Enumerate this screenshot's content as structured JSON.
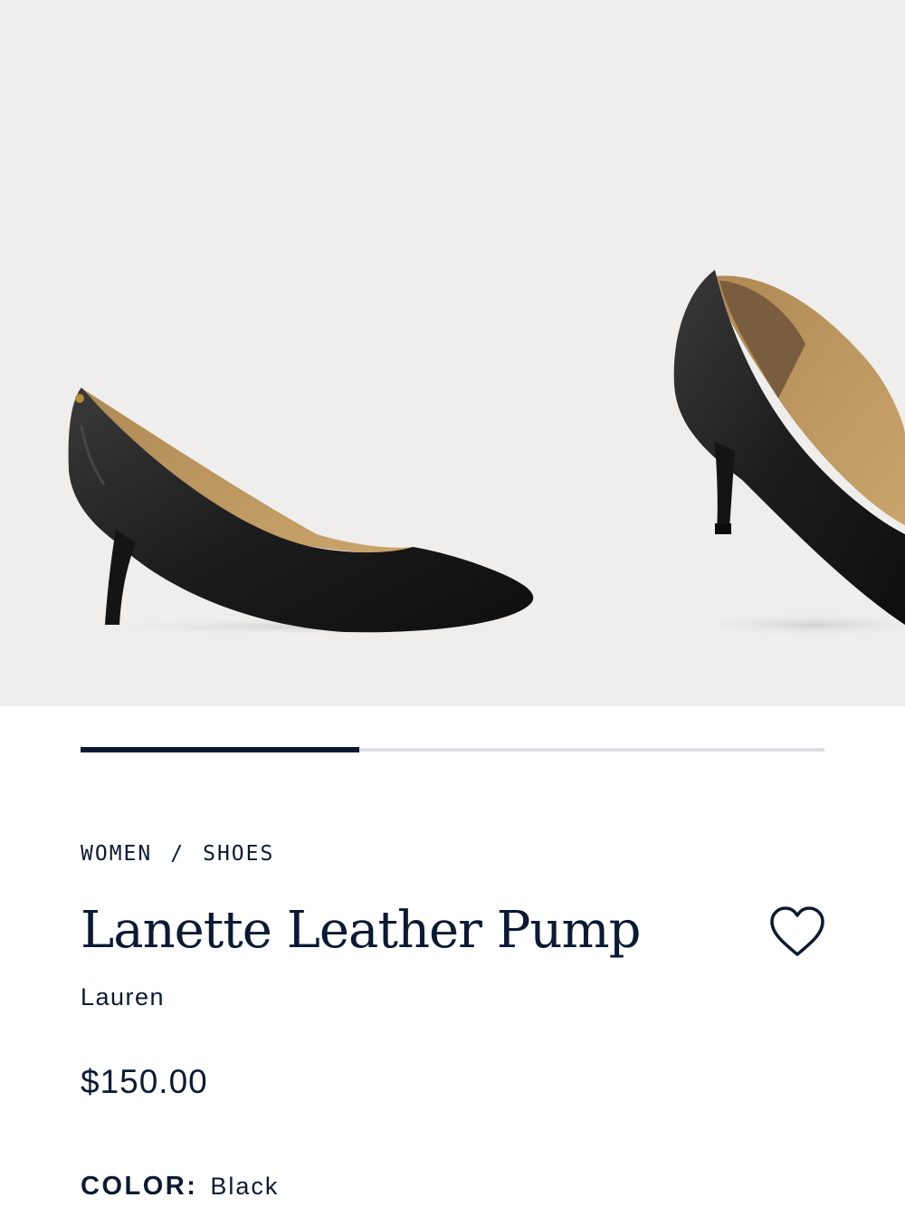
{
  "gallery": {
    "images": [
      {
        "alt": "shoe-side-view-icon"
      },
      {
        "alt": "shoe-three-quarter-view-icon"
      }
    ],
    "progress": 0.375
  },
  "breadcrumb": {
    "items": [
      "WOMEN",
      "SHOES"
    ],
    "separator": "/"
  },
  "product": {
    "title": "Lanette Leather Pump",
    "brand": "Lauren",
    "price": "$150.00",
    "color_label": "COLOR:",
    "color_value": "Black"
  },
  "icons": {
    "favorite": "heart-icon"
  },
  "colors": {
    "navy": "#0b1a33",
    "gallery_bg": "#efeeed",
    "track": "#dedde3"
  }
}
